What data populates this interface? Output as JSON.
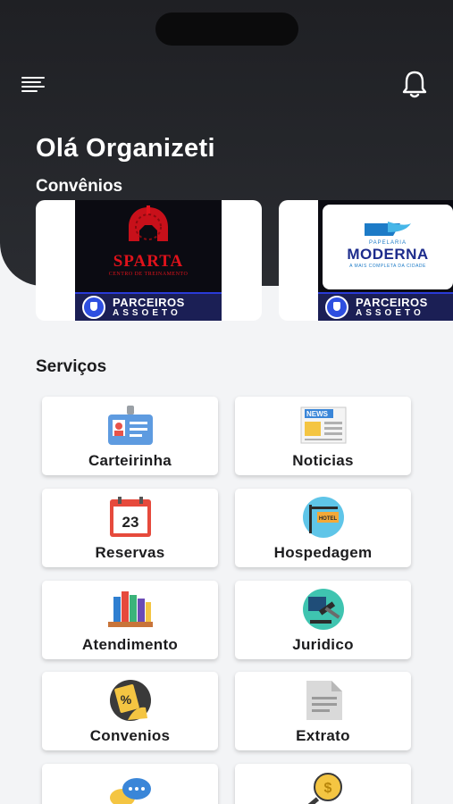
{
  "header": {
    "greeting": "Olá Organizeti",
    "convenios_title": "Convênios"
  },
  "banners": [
    {
      "brand": "SPARTA",
      "brand_subtitle": "CENTRO DE TREINAMENTO",
      "footer_line1": "PARCEIROS",
      "footer_line2": "ASSOETO"
    },
    {
      "brand_top": "PAPELARIA",
      "brand": "MODERNA",
      "brand_subtitle": "A MAIS COMPLETA DA CIDADE",
      "footer_line1": "PARCEIROS",
      "footer_line2": "ASSOETO"
    }
  ],
  "services": {
    "title": "Serviços",
    "items": [
      {
        "label": "Carteirinha",
        "icon": "id-card-icon"
      },
      {
        "label": "Noticias",
        "icon": "newspaper-icon"
      },
      {
        "label": "Reservas",
        "icon": "calendar-icon",
        "icon_text": "23"
      },
      {
        "label": "Hospedagem",
        "icon": "hotel-sign-icon",
        "icon_text": "HOTEL"
      },
      {
        "label": "Atendimento",
        "icon": "books-icon"
      },
      {
        "label": "Juridico",
        "icon": "gavel-icon"
      },
      {
        "label": "Convenios",
        "icon": "discount-tag-icon"
      },
      {
        "label": "Extrato",
        "icon": "document-icon"
      },
      {
        "label": "",
        "icon": "chat-bubbles-icon"
      },
      {
        "label": "",
        "icon": "money-search-icon"
      }
    ]
  },
  "colors": {
    "header_bg": "#25272b",
    "page_bg": "#f3f4f6",
    "sparta_red": "#e0121b",
    "parceiros_blue": "#1b1f55"
  }
}
